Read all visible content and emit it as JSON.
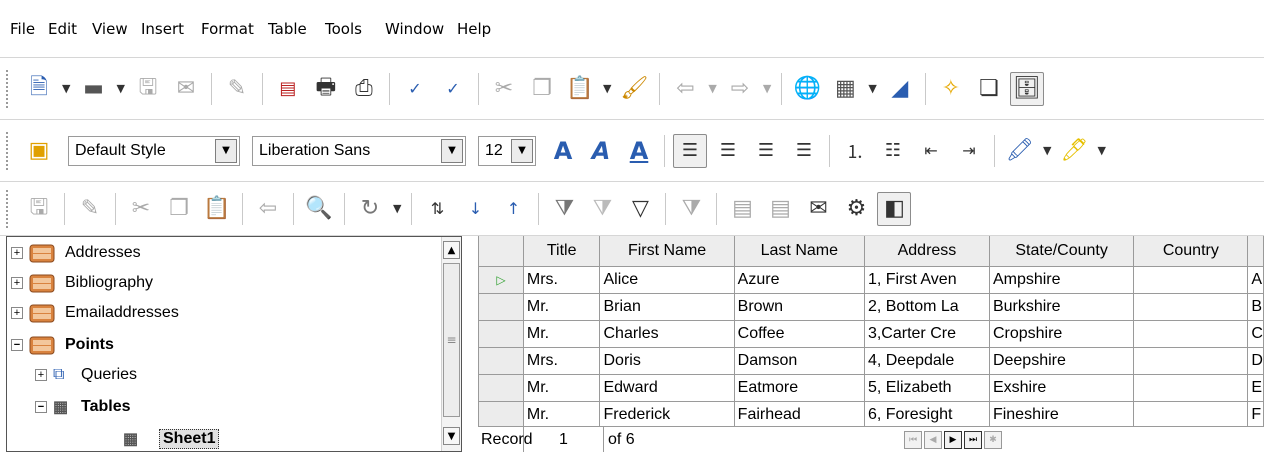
{
  "menu": [
    "File",
    "Edit",
    "View",
    "Insert",
    "Format",
    "Table",
    "Tools",
    "Window",
    "Help"
  ],
  "formatting": {
    "paragraph_style": "Default Style",
    "font_name": "Liberation Sans",
    "font_size": "12"
  },
  "navigator": {
    "items": [
      {
        "label": "Addresses",
        "expander": "+",
        "bold": false
      },
      {
        "label": "Bibliography",
        "expander": "+",
        "bold": false
      },
      {
        "label": "Emailaddresses",
        "expander": "+",
        "bold": false
      },
      {
        "label": "Points",
        "expander": "−",
        "bold": true
      },
      {
        "label": "Queries",
        "expander": "+",
        "bold": false
      },
      {
        "label": "Tables",
        "expander": "−",
        "bold": true
      },
      {
        "label": "Sheet1",
        "expander": "",
        "bold": true
      }
    ]
  },
  "grid": {
    "columns": [
      "Title",
      "First Name",
      "Last Name",
      "Address",
      "State/County",
      "Country"
    ],
    "rows": [
      [
        "Mrs.",
        "Alice",
        "Azure",
        "1, First Aven",
        "Ampshire",
        "",
        "A"
      ],
      [
        "Mr.",
        "Brian",
        "Brown",
        "2, Bottom La",
        "Burkshire",
        "",
        "B"
      ],
      [
        "Mr.",
        "Charles",
        "Coffee",
        "3,Carter Cre",
        "Cropshire",
        "",
        "C"
      ],
      [
        "Mrs.",
        "Doris",
        "Damson",
        "4, Deepdale",
        "Deepshire",
        "",
        "D"
      ],
      [
        "Mr.",
        "Edward",
        "Eatmore",
        "5, Elizabeth",
        "Exshire",
        "",
        "E"
      ],
      [
        "Mr.",
        "Frederick",
        "Fairhead",
        "6, Foresight",
        "Fineshire",
        "",
        "F"
      ]
    ],
    "current_row_marker": "▷"
  },
  "record_bar": {
    "label": "Record",
    "current": "1",
    "of_text": "of 6"
  }
}
